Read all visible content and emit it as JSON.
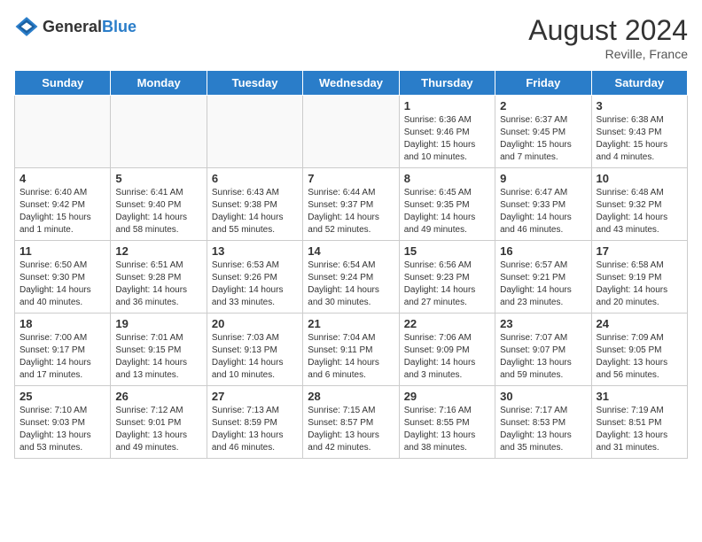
{
  "header": {
    "logo_general": "General",
    "logo_blue": "Blue",
    "month_year": "August 2024",
    "location": "Reville, France"
  },
  "days_of_week": [
    "Sunday",
    "Monday",
    "Tuesday",
    "Wednesday",
    "Thursday",
    "Friday",
    "Saturday"
  ],
  "weeks": [
    [
      {
        "day": "",
        "content": ""
      },
      {
        "day": "",
        "content": ""
      },
      {
        "day": "",
        "content": ""
      },
      {
        "day": "",
        "content": ""
      },
      {
        "day": "1",
        "content": "Sunrise: 6:36 AM\nSunset: 9:46 PM\nDaylight: 15 hours\nand 10 minutes."
      },
      {
        "day": "2",
        "content": "Sunrise: 6:37 AM\nSunset: 9:45 PM\nDaylight: 15 hours\nand 7 minutes."
      },
      {
        "day": "3",
        "content": "Sunrise: 6:38 AM\nSunset: 9:43 PM\nDaylight: 15 hours\nand 4 minutes."
      }
    ],
    [
      {
        "day": "4",
        "content": "Sunrise: 6:40 AM\nSunset: 9:42 PM\nDaylight: 15 hours\nand 1 minute."
      },
      {
        "day": "5",
        "content": "Sunrise: 6:41 AM\nSunset: 9:40 PM\nDaylight: 14 hours\nand 58 minutes."
      },
      {
        "day": "6",
        "content": "Sunrise: 6:43 AM\nSunset: 9:38 PM\nDaylight: 14 hours\nand 55 minutes."
      },
      {
        "day": "7",
        "content": "Sunrise: 6:44 AM\nSunset: 9:37 PM\nDaylight: 14 hours\nand 52 minutes."
      },
      {
        "day": "8",
        "content": "Sunrise: 6:45 AM\nSunset: 9:35 PM\nDaylight: 14 hours\nand 49 minutes."
      },
      {
        "day": "9",
        "content": "Sunrise: 6:47 AM\nSunset: 9:33 PM\nDaylight: 14 hours\nand 46 minutes."
      },
      {
        "day": "10",
        "content": "Sunrise: 6:48 AM\nSunset: 9:32 PM\nDaylight: 14 hours\nand 43 minutes."
      }
    ],
    [
      {
        "day": "11",
        "content": "Sunrise: 6:50 AM\nSunset: 9:30 PM\nDaylight: 14 hours\nand 40 minutes."
      },
      {
        "day": "12",
        "content": "Sunrise: 6:51 AM\nSunset: 9:28 PM\nDaylight: 14 hours\nand 36 minutes."
      },
      {
        "day": "13",
        "content": "Sunrise: 6:53 AM\nSunset: 9:26 PM\nDaylight: 14 hours\nand 33 minutes."
      },
      {
        "day": "14",
        "content": "Sunrise: 6:54 AM\nSunset: 9:24 PM\nDaylight: 14 hours\nand 30 minutes."
      },
      {
        "day": "15",
        "content": "Sunrise: 6:56 AM\nSunset: 9:23 PM\nDaylight: 14 hours\nand 27 minutes."
      },
      {
        "day": "16",
        "content": "Sunrise: 6:57 AM\nSunset: 9:21 PM\nDaylight: 14 hours\nand 23 minutes."
      },
      {
        "day": "17",
        "content": "Sunrise: 6:58 AM\nSunset: 9:19 PM\nDaylight: 14 hours\nand 20 minutes."
      }
    ],
    [
      {
        "day": "18",
        "content": "Sunrise: 7:00 AM\nSunset: 9:17 PM\nDaylight: 14 hours\nand 17 minutes."
      },
      {
        "day": "19",
        "content": "Sunrise: 7:01 AM\nSunset: 9:15 PM\nDaylight: 14 hours\nand 13 minutes."
      },
      {
        "day": "20",
        "content": "Sunrise: 7:03 AM\nSunset: 9:13 PM\nDaylight: 14 hours\nand 10 minutes."
      },
      {
        "day": "21",
        "content": "Sunrise: 7:04 AM\nSunset: 9:11 PM\nDaylight: 14 hours\nand 6 minutes."
      },
      {
        "day": "22",
        "content": "Sunrise: 7:06 AM\nSunset: 9:09 PM\nDaylight: 14 hours\nand 3 minutes."
      },
      {
        "day": "23",
        "content": "Sunrise: 7:07 AM\nSunset: 9:07 PM\nDaylight: 13 hours\nand 59 minutes."
      },
      {
        "day": "24",
        "content": "Sunrise: 7:09 AM\nSunset: 9:05 PM\nDaylight: 13 hours\nand 56 minutes."
      }
    ],
    [
      {
        "day": "25",
        "content": "Sunrise: 7:10 AM\nSunset: 9:03 PM\nDaylight: 13 hours\nand 53 minutes."
      },
      {
        "day": "26",
        "content": "Sunrise: 7:12 AM\nSunset: 9:01 PM\nDaylight: 13 hours\nand 49 minutes."
      },
      {
        "day": "27",
        "content": "Sunrise: 7:13 AM\nSunset: 8:59 PM\nDaylight: 13 hours\nand 46 minutes."
      },
      {
        "day": "28",
        "content": "Sunrise: 7:15 AM\nSunset: 8:57 PM\nDaylight: 13 hours\nand 42 minutes."
      },
      {
        "day": "29",
        "content": "Sunrise: 7:16 AM\nSunset: 8:55 PM\nDaylight: 13 hours\nand 38 minutes."
      },
      {
        "day": "30",
        "content": "Sunrise: 7:17 AM\nSunset: 8:53 PM\nDaylight: 13 hours\nand 35 minutes."
      },
      {
        "day": "31",
        "content": "Sunrise: 7:19 AM\nSunset: 8:51 PM\nDaylight: 13 hours\nand 31 minutes."
      }
    ]
  ]
}
